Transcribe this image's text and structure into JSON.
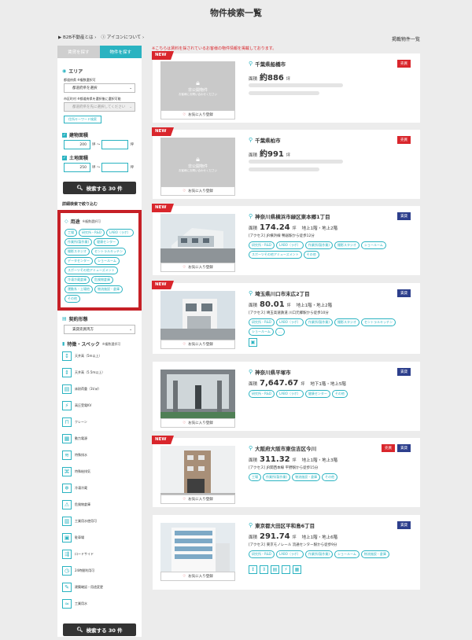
{
  "page_title": "物件検索一覧",
  "top_links": [
    "B2B不動産とは",
    "アイコンについて"
  ],
  "notice": "※こちらは賃料を採されているお客様の物件情報を掲載しております。",
  "listed_label": "掲載物件一覧",
  "sidebar": {
    "tabs": [
      "賃貸を探す",
      "物件を探す"
    ],
    "area_title": "エリア",
    "pref_label": "都道府県",
    "pref_note": "※複数選択可",
    "pref_value": "都道府県を選択",
    "city_label": "市区町村",
    "city_note": "※都道府県を選択後に選択可能",
    "city_value": "都道府県を先に選択してください",
    "keyword_btn": "住所キーワード検索",
    "bldg_title": "建物面積",
    "bldg_min": "200",
    "bldg_tilde": "坪 〜",
    "unit": "坪",
    "land_title": "土地面積",
    "land_min": "250",
    "search_btn": "検索する 30 件",
    "refine_title": "詳細検索で絞り込む",
    "use_title": "用途",
    "use_note": "※複数選択可",
    "use_tags": [
      "工場",
      "研究所・R&D",
      "LABO（ラボ）",
      "作業所(製作業)",
      "健康センター",
      "撮影スタジオ",
      "セントラルキッチン",
      "データセンター",
      "ショールーム",
      "スポーツその他アミューズメント",
      "冷凍冷蔵倉庫",
      "危険物倉庫",
      "運動系・土場他",
      "物流施設・倉庫",
      "その他"
    ],
    "contract_title": "契約形態",
    "contract_value": "賃貸売買両方",
    "spec_title": "特徴・スペック",
    "spec_note": "※複数選択可",
    "specs": [
      {
        "label": "天井高（5m以上）",
        "icon": "↕"
      },
      {
        "label": "天井高（5.5m以上）",
        "icon": "⇕"
      },
      {
        "label": "床耐荷重（1t/㎡）",
        "icon": "▤"
      },
      {
        "label": "高圧受電KV",
        "icon": "⚡"
      },
      {
        "label": "クレーン",
        "icon": "⊓"
      },
      {
        "label": "動力電源",
        "icon": "▦"
      },
      {
        "label": "特殊排水",
        "icon": "≋"
      },
      {
        "label": "特殊給排気",
        "icon": "⌘"
      },
      {
        "label": "冷凍冷蔵",
        "icon": "❄"
      },
      {
        "label": "危険物倉庫",
        "icon": "⚠"
      },
      {
        "label": "工業用水使用可",
        "icon": "▥"
      },
      {
        "label": "駐車場",
        "icon": "▣"
      },
      {
        "label": "ロードサイド",
        "icon": "⇶"
      },
      {
        "label": "24時間利用可",
        "icon": "◷"
      },
      {
        "label": "建築確認・用途変更",
        "icon": "✎"
      },
      {
        "label": "工業用水",
        "icon": "≈"
      }
    ],
    "search_btn_bottom": "検索する 30 件"
  },
  "cards": [
    {
      "new": "NEW",
      "address": "千葉県船橋市",
      "area_label": "面積",
      "area": "約886",
      "area_unit": "坪",
      "floors": "",
      "access": "",
      "badges": [
        "売買"
      ],
      "private_title": "非公開物件",
      "private_sub": "お客様にお問い合わせください",
      "fav": "お気に入り登録",
      "tags": []
    },
    {
      "new": "NEW",
      "address": "千葉県柏市",
      "area_label": "面積",
      "area": "約991",
      "area_unit": "坪",
      "floors": "",
      "access": "",
      "badges": [
        "売買"
      ],
      "private_title": "非公開物件",
      "private_sub": "お客様にお問い合わせください",
      "fav": "お気に入り登録",
      "tags": []
    },
    {
      "new": "NEW",
      "address": "神奈川県横浜市緑区東本郷1丁目",
      "area_label": "面積",
      "area": "174.24",
      "area_unit": "坪",
      "floors": "地上1階・地上2階",
      "access": "[アクセス] JR横浜線 鴨居駅から徒歩12分",
      "badges": [
        "賃貸"
      ],
      "fav": "お気に入り登録",
      "tags": [
        "研究所・R&D",
        "LABO（ラボ）",
        "作業所(製作業)",
        "撮影スタジオ",
        "ショールーム",
        "スポーツその他アミューズメント",
        "その他"
      ]
    },
    {
      "new": "NEW",
      "address": "埼玉県川口市末広2丁目",
      "area_label": "面積",
      "area": "80.01",
      "area_unit": "坪",
      "floors": "地上1階・地上2階",
      "access": "[アクセス] 埼玉高速鉄道 川口元郷駅から徒歩10分",
      "badges": [
        "賃貸"
      ],
      "fav": "お気に入り登録",
      "tags": [
        "研究所・R&D",
        "LABO（ラボ）",
        "作業所(製作業)",
        "撮影スタジオ",
        "セントラルキッチン",
        "ショールーム",
        "…"
      ]
    },
    {
      "new": "",
      "address": "神奈川県平塚市",
      "area_label": "面積",
      "area": "7,647.67",
      "area_unit": "坪",
      "floors": "地下1階・地上5階",
      "access": "",
      "badges": [
        "賃貸"
      ],
      "fav": "お気に入り登録",
      "tags": [
        "研究所・R&D",
        "LABO（ラボ）",
        "健康センター",
        "その他"
      ]
    },
    {
      "new": "NEW",
      "address": "大阪府大阪市東住吉区今川",
      "area_label": "面積",
      "area": "311.32",
      "area_unit": "坪",
      "floors": "地上1階・地上3階",
      "access": "[アクセス] JR関西本線 平野駅から徒歩15分",
      "badges": [
        "売買",
        "賃貸"
      ],
      "fav": "お気に入り登録",
      "tags": [
        "工場",
        "作業所(製作業)",
        "物流施設・倉庫",
        "その他"
      ]
    },
    {
      "new": "",
      "address": "東京都大田区平和島6丁目",
      "area_label": "面積",
      "area": "291.74",
      "area_unit": "坪",
      "floors": "地上1階・地上6階",
      "access": "[アクセス] 東京モノレール 流通センター駅から徒歩9分",
      "badges": [
        "賃貸"
      ],
      "fav": "お気に入り登録",
      "tags": [
        "研究所・R&D",
        "LABO（ラボ）",
        "作業所(製作業)",
        "ショールーム",
        "物流施設・倉庫"
      ]
    }
  ]
}
